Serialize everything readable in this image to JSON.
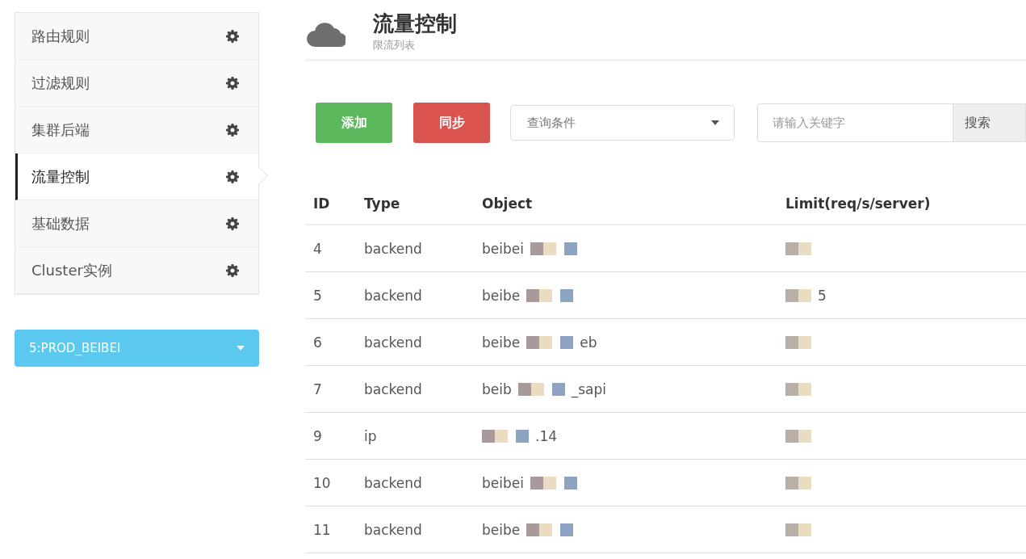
{
  "sidebar": {
    "items": [
      {
        "label": "路由规则",
        "selected": false
      },
      {
        "label": "过滤规则",
        "selected": false
      },
      {
        "label": "集群后端",
        "selected": false
      },
      {
        "label": "流量控制",
        "selected": true
      },
      {
        "label": "基础数据",
        "selected": false
      },
      {
        "label": "Cluster实例",
        "selected": false
      }
    ],
    "cluster_dropdown": {
      "value": "5:PROD_BEIBEI"
    }
  },
  "header": {
    "title": "流量控制",
    "subtitle": "限流列表"
  },
  "toolbar": {
    "add_button": "添加",
    "sync_button": "同步",
    "query_select": {
      "placeholder": "查询条件"
    },
    "search": {
      "placeholder": "请输入关键字",
      "button": "搜索"
    }
  },
  "table": {
    "columns": [
      "ID",
      "Type",
      "Object",
      "Limit(req/s/server)"
    ],
    "rows": [
      {
        "id": "4",
        "type": "backend",
        "object": [
          {
            "kind": "text",
            "text": "beibei"
          },
          {
            "kind": "mask"
          }
        ],
        "limit": [
          {
            "kind": "mask"
          }
        ]
      },
      {
        "id": "5",
        "type": "backend",
        "object": [
          {
            "kind": "text",
            "text": "beibe"
          },
          {
            "kind": "mask"
          }
        ],
        "limit": [
          {
            "kind": "mask"
          },
          {
            "kind": "text",
            "text": "5"
          }
        ]
      },
      {
        "id": "6",
        "type": "backend",
        "object": [
          {
            "kind": "text",
            "text": "beibe"
          },
          {
            "kind": "mask"
          },
          {
            "kind": "text",
            "text": "eb"
          }
        ],
        "limit": [
          {
            "kind": "mask"
          }
        ]
      },
      {
        "id": "7",
        "type": "backend",
        "object": [
          {
            "kind": "text",
            "text": "beib"
          },
          {
            "kind": "mask"
          },
          {
            "kind": "text",
            "text": "_sapi"
          }
        ],
        "limit": [
          {
            "kind": "mask"
          }
        ]
      },
      {
        "id": "9",
        "type": "ip",
        "object": [
          {
            "kind": "mask"
          },
          {
            "kind": "text",
            "text": ".14"
          }
        ],
        "limit": [
          {
            "kind": "mask"
          }
        ]
      },
      {
        "id": "10",
        "type": "backend",
        "object": [
          {
            "kind": "text",
            "text": "beibei"
          },
          {
            "kind": "mask"
          }
        ],
        "limit": [
          {
            "kind": "mask"
          }
        ]
      },
      {
        "id": "11",
        "type": "backend",
        "object": [
          {
            "kind": "text",
            "text": "beibe"
          },
          {
            "kind": "mask"
          }
        ],
        "limit": [
          {
            "kind": "mask"
          }
        ]
      }
    ]
  }
}
